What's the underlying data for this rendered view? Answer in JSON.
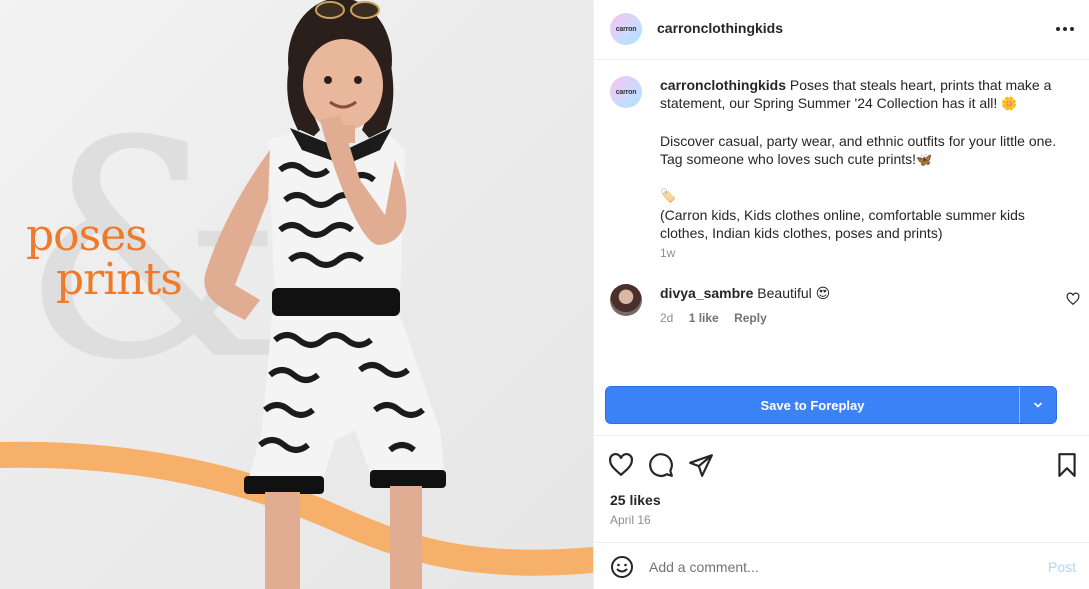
{
  "media": {
    "promo_line1": "poses",
    "promo_line2": "prints"
  },
  "header": {
    "avatar_text": "carron",
    "username": "carronclothingkids",
    "more_icon": "more-horizontal-icon"
  },
  "caption": {
    "avatar_text": "carron",
    "username": "carronclothingkids",
    "line1": "Poses that steals heart, prints that make a statement, our Spring Summer '24 Collection has it all!",
    "emoji1": "🌼",
    "line2": "Discover casual, party wear, and ethnic outfits for your little one. Tag someone who loves such cute prints!",
    "emoji2": "🦋",
    "emoji3": "🏷️",
    "tags": "(Carron kids, Kids clothes online, comfortable summer kids clothes, Indian kids clothes, poses and prints)",
    "time_ago": "1w"
  },
  "comment": {
    "username": "divya_sambre",
    "text": "Beautiful",
    "emoji": "😍",
    "time": "2d",
    "likes": "1 like",
    "reply": "Reply"
  },
  "save_button": {
    "label": "Save to Foreplay",
    "dropdown_icon": "chevron-down-icon"
  },
  "actions": {
    "like_icon": "heart-icon",
    "comment_icon": "comment-icon",
    "share_icon": "send-icon",
    "save_icon": "bookmark-icon"
  },
  "likes_text": "25 likes",
  "date_text": "April 16",
  "add_comment": {
    "placeholder": "Add a comment...",
    "post_label": "Post",
    "emoji_icon": "smiley-icon"
  },
  "colors": {
    "accent_blue": "#3b82f6",
    "brand_orange": "#ee7a2a",
    "post_disabled": "#b3d4fc"
  }
}
